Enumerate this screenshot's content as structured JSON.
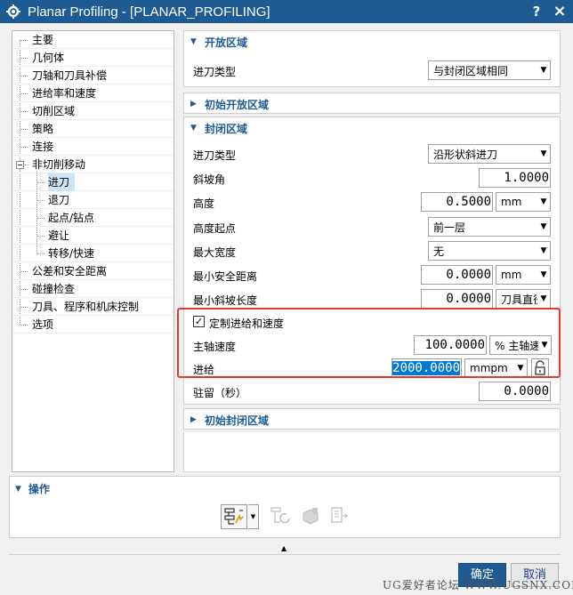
{
  "window": {
    "title": "Planar Profiling - [PLANAR_PROFILING]",
    "help_label": "?",
    "close_label": "×",
    "icon": "gear-icon"
  },
  "tree": {
    "items": [
      {
        "label": "主要"
      },
      {
        "label": "几何体"
      },
      {
        "label": "刀轴和刀具补偿"
      },
      {
        "label": "进给率和速度"
      },
      {
        "label": "切削区域"
      },
      {
        "label": "策略"
      },
      {
        "label": "连接"
      },
      {
        "label": "非切削移动"
      },
      {
        "label": "进刀",
        "selected": true
      },
      {
        "label": "退刀"
      },
      {
        "label": "起点/钻点"
      },
      {
        "label": "避让"
      },
      {
        "label": "转移/快速"
      },
      {
        "label": "公差和安全距离"
      },
      {
        "label": "碰撞检查"
      },
      {
        "label": "刀具、程序和机床控制"
      },
      {
        "label": "选项"
      }
    ]
  },
  "open_area": {
    "title": "开放区域",
    "entry_type_label": "进刀类型",
    "entry_type_value": "与封闭区域相同"
  },
  "initial_open_area": {
    "title": "初始开放区域"
  },
  "closed_area": {
    "title": "封闭区域",
    "entry_type_label": "进刀类型",
    "entry_type_value": "沿形状斜进刀",
    "ramp_angle_label": "斜坡角",
    "ramp_angle_value": "1.0000",
    "height_label": "高度",
    "height_value": "0.5000",
    "height_unit": "mm",
    "height_from_label": "高度起点",
    "height_from_value": "前一层",
    "max_width_label": "最大宽度",
    "max_width_value": "无",
    "min_clearance_label": "最小安全距离",
    "min_clearance_value": "0.0000",
    "min_clearance_unit": "mm",
    "min_ramp_length_label": "最小斜坡长度",
    "min_ramp_length_value": "0.0000",
    "min_ramp_length_unit": "刀具直径",
    "custom_feed_label": "定制进给和速度",
    "custom_feed_checked": true,
    "spindle_speed_label": "主轴速度",
    "spindle_speed_value": "100.0000",
    "spindle_speed_unit": "% 主轴速",
    "feed_label": "进给",
    "feed_value": "2000.0000",
    "feed_unit": "mmpm",
    "dwell_label": "驻留（秒）",
    "dwell_value": "0.0000"
  },
  "initial_closed_area": {
    "title": "初始封闭区域"
  },
  "operations": {
    "title": "操作",
    "buttons": [
      "generate-icon",
      "replay-icon",
      "verify-icon",
      "list-icon"
    ]
  },
  "footer": {
    "ok_label": "确定",
    "cancel_label": "取消",
    "watermark": "UG爱好者论坛 WWW.UGSNX.COM"
  },
  "colors": {
    "title_bar": "#1e5b93",
    "section_header": "#1e5b93",
    "highlight_box": "#e53935",
    "selection": "#0078d7"
  }
}
